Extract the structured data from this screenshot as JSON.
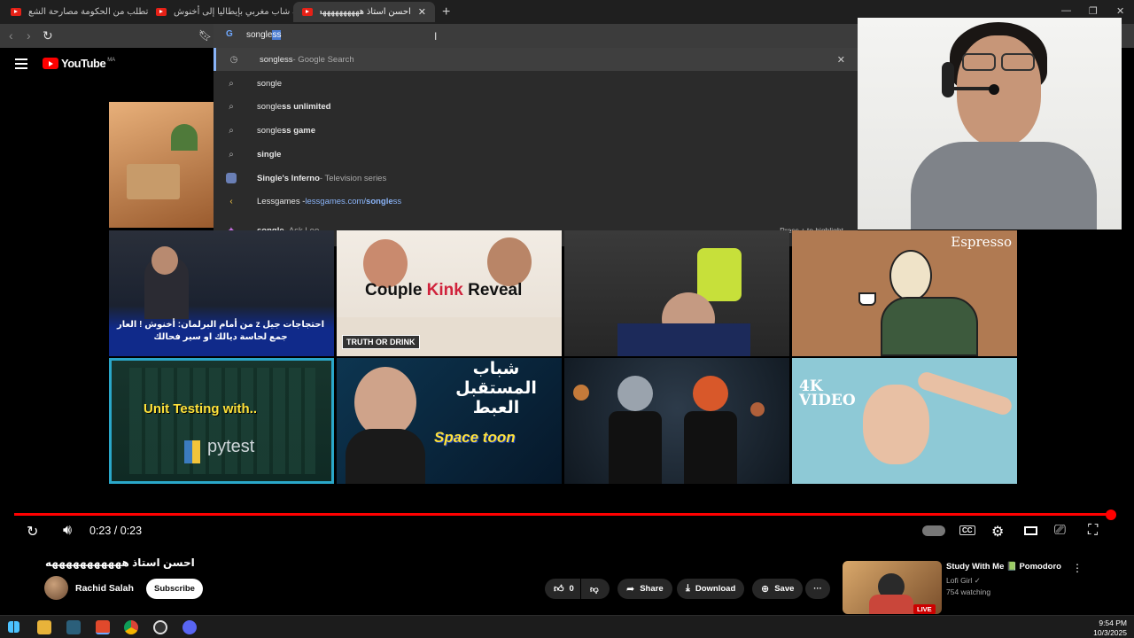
{
  "browser": {
    "tabs": [
      {
        "title": "طبيبة تطلب من الحكومة مصارحة الشع"
      },
      {
        "title": "رسالة شاب مغربي بإيطاليا إلى أخنوش"
      },
      {
        "title": "احسن استاذ ههههههههههه - YouTube"
      }
    ],
    "new_tab": "+",
    "win_controls": {
      "minimize": "—",
      "restore": "❐",
      "close": "✕"
    },
    "omnibox": {
      "typed": "songle",
      "autocomplete": "ss"
    }
  },
  "suggestions": [
    {
      "icon": "history-icon",
      "text": "songless",
      "suffix": " - Google Search",
      "remove": "✕"
    },
    {
      "icon": "search-icon",
      "bold": "",
      "plain": "songle"
    },
    {
      "icon": "search-icon",
      "plain": "songle",
      "bold": "ss unlimited"
    },
    {
      "icon": "search-icon",
      "plain": "songle",
      "bold": "ss game"
    },
    {
      "icon": "search-icon",
      "plain": "",
      "bold": "single"
    },
    {
      "icon": "entity-icon",
      "bold": "Single's Inferno",
      "dim": " - Television series"
    },
    {
      "icon": "site-icon",
      "plain": "Lessgames - ",
      "url": "lessgames.com/",
      "url_bold": "songle",
      "url_rest": "ss"
    },
    {
      "icon": "leo-icon",
      "bold": "songle",
      "dim": " - Ask Leo",
      "hint": "Press ↑ to highlight"
    }
  ],
  "youtube": {
    "logo": "YouTube",
    "region": "MA",
    "thumbs": [
      {
        "caption": ""
      },
      {
        "caption": "احتجاجات جيل z من أمام البرلمان: أخنوش ! العار جمع لحاسة ديالك او سير فحالك"
      },
      {
        "caption": "Couple Kink Reveal",
        "caption_a": "Couple ",
        "caption_b": "Kink",
        "caption_c": " Reveal",
        "badge": "TRUTH OR DRINK"
      },
      {
        "caption": ""
      },
      {
        "caption": "Espresso"
      },
      {
        "caption": "Unit Testing with..",
        "sub": "pytest"
      },
      {
        "caption": "شباب المستقبل العبط",
        "sub": "Space toon"
      },
      {
        "caption": ""
      },
      {
        "caption": "4K VIDEO"
      }
    ]
  },
  "player": {
    "time": "0:23 / 0:23",
    "progress_fraction": 1.0,
    "cc": "CC"
  },
  "video": {
    "title": "احسن استاذ هههههههههههه",
    "channel": "Rachid Salah",
    "subscribe": "Subscribe",
    "likes": "0",
    "share": "Share",
    "download": "Download",
    "save": "Save"
  },
  "recommended": {
    "title": "Study With Me 📗 Pomodoro",
    "channel": "Lofi Girl ✓",
    "meta": "754 watching",
    "badge": "LIVE"
  },
  "taskbar": {
    "time": "9:54 PM",
    "date": "10/3/2025"
  }
}
